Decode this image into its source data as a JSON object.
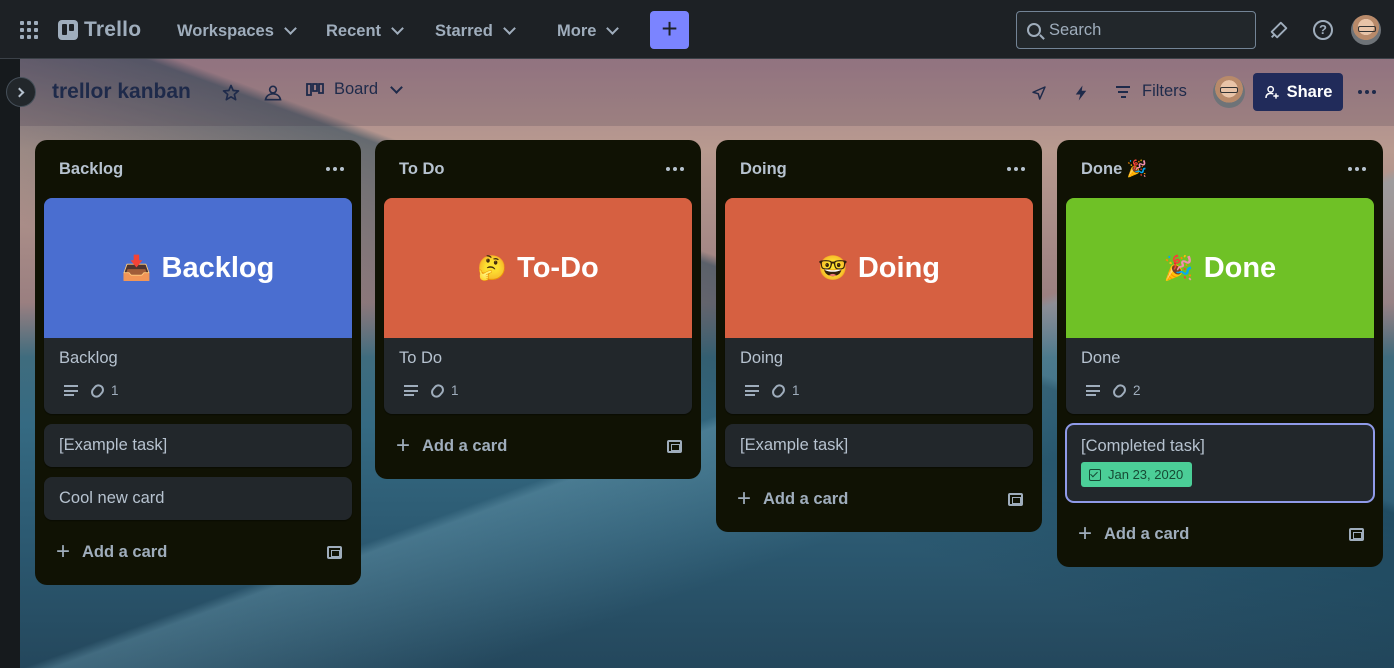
{
  "nav": {
    "logo": "Trello",
    "workspaces": "Workspaces",
    "recent": "Recent",
    "starred": "Starred",
    "more": "More",
    "create": "+",
    "search_placeholder": "Search",
    "help": "?"
  },
  "board": {
    "title": "trellor kanban",
    "view": "Board",
    "filters": "Filters",
    "share": "Share"
  },
  "lists": [
    {
      "name": "Backlog",
      "cover_card": {
        "cover_text": "Backlog",
        "cover_emoji": "📥",
        "cover_color": "#4a6ed0",
        "title": "Backlog",
        "attachments": "1"
      },
      "cards": [
        "[Example task]",
        "Cool new card"
      ],
      "add_label": "Add a card"
    },
    {
      "name": "To Do",
      "cover_card": {
        "cover_text": "To-Do",
        "cover_emoji": "🤔",
        "cover_color": "#d66041",
        "title": "To Do",
        "attachments": "1"
      },
      "cards": [],
      "add_label": "Add a card"
    },
    {
      "name": "Doing",
      "cover_card": {
        "cover_text": "Doing",
        "cover_emoji": "🤓",
        "cover_color": "#d66041",
        "title": "Doing",
        "attachments": "1"
      },
      "cards": [
        "[Example task]"
      ],
      "add_label": "Add a card"
    },
    {
      "name": "Done 🎉",
      "cover_card": {
        "cover_text": "Done",
        "cover_emoji": "🎉",
        "cover_color": "#6fc126",
        "title": "Done",
        "attachments": "2"
      },
      "cards": [
        "[Completed task]"
      ],
      "due_badge": "Jan 23, 2020",
      "add_label": "Add a card"
    }
  ]
}
